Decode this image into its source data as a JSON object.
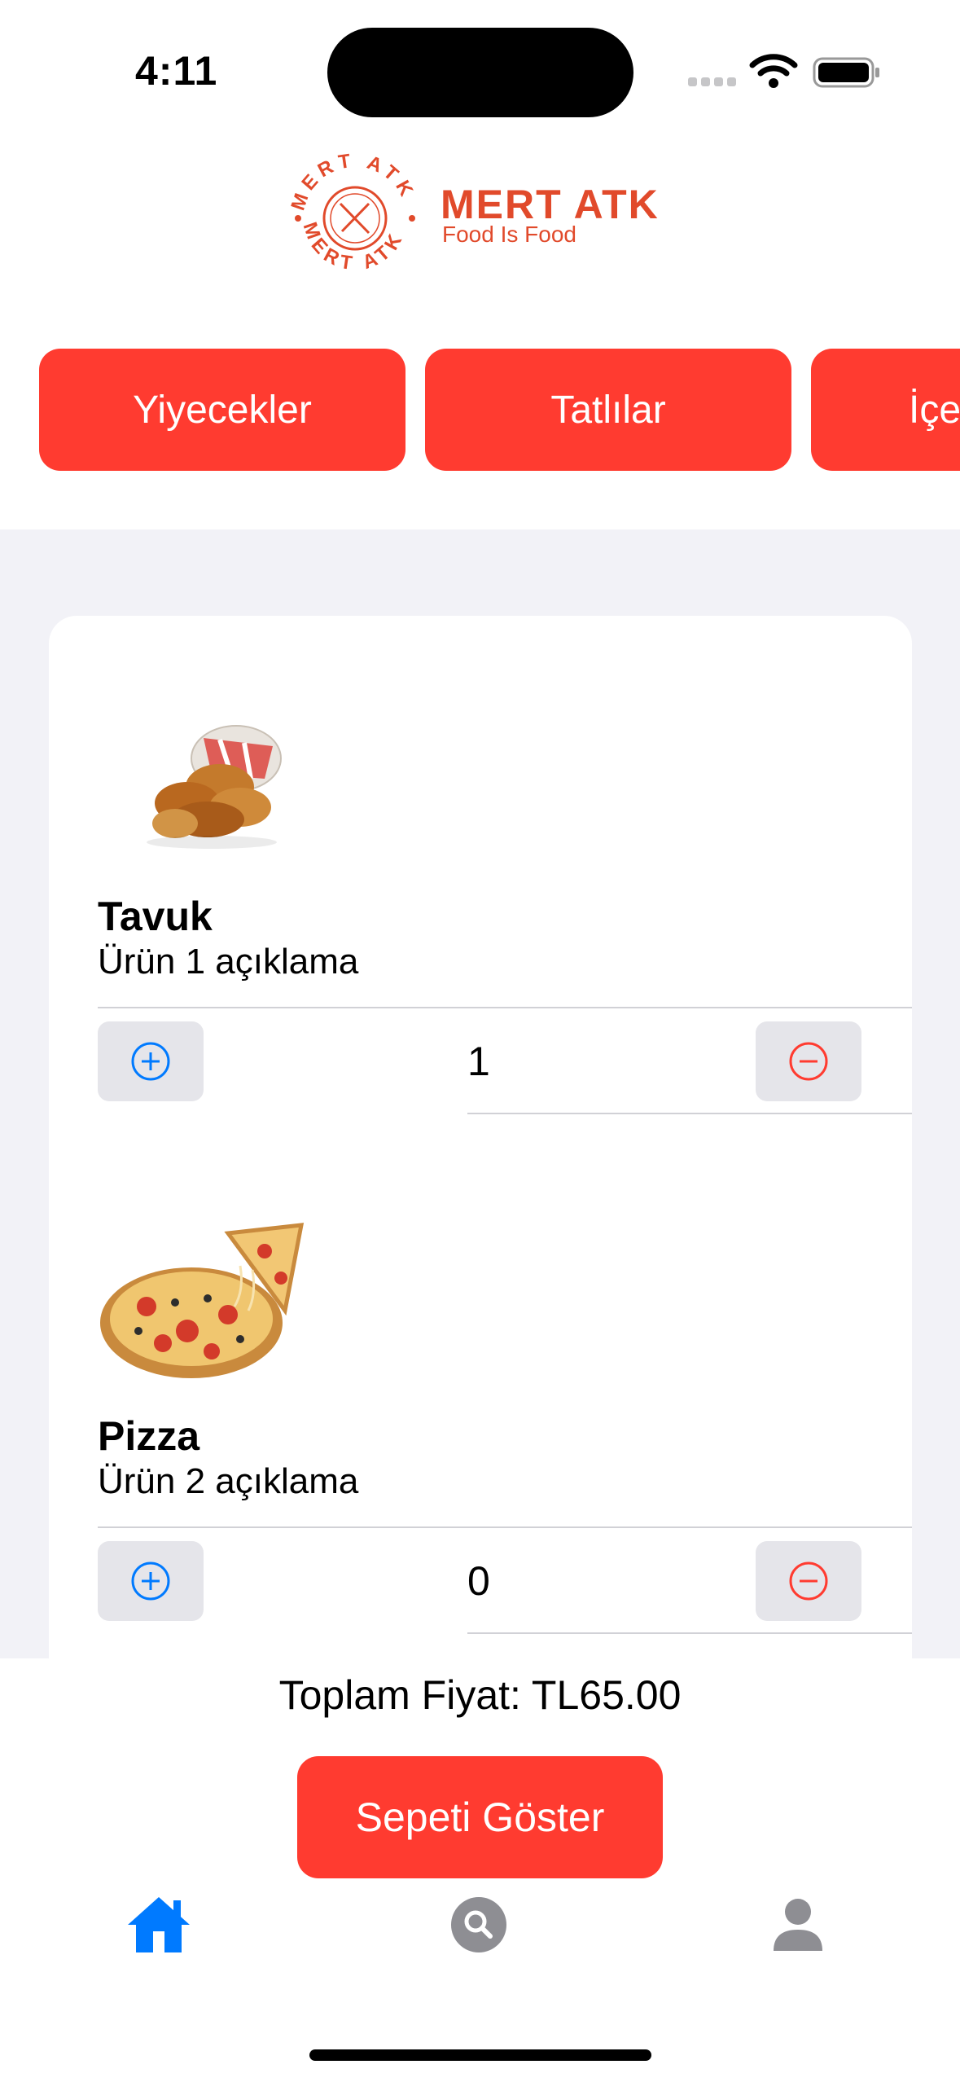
{
  "status_bar": {
    "time": "4:11"
  },
  "brand": {
    "name": "MERT ATK",
    "tagline": "Food Is Food",
    "ring_text": "MERT ATK MERT ATK"
  },
  "categories": [
    {
      "label": "Yiyecekler"
    },
    {
      "label": "Tatlılar"
    },
    {
      "label": "İçe"
    }
  ],
  "products": [
    {
      "name": "Tavuk",
      "description": "Ürün 1 açıklama",
      "quantity": "1",
      "image": "fried-chicken"
    },
    {
      "name": "Pizza",
      "description": "Ürün 2 açıklama",
      "quantity": "0",
      "image": "pizza"
    }
  ],
  "footer": {
    "total": "Toplam Fiyat: TL65.00",
    "show_cart": "Sepeti Göster"
  },
  "tabs": [
    {
      "icon": "home-icon",
      "active": true
    },
    {
      "icon": "search-icon",
      "active": false
    },
    {
      "icon": "profile-icon",
      "active": false
    }
  ],
  "colors": {
    "accent": "#ff3b30",
    "brand": "#e14a2b",
    "tab_active": "#007aff",
    "tab_inactive": "#8e8e93"
  }
}
